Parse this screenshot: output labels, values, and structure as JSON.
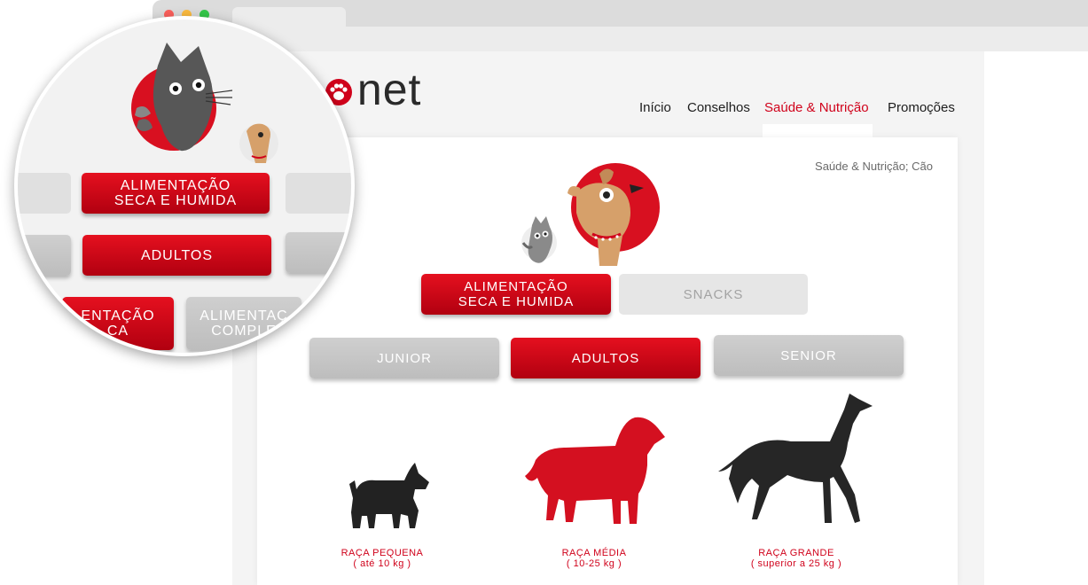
{
  "site": {
    "logo_text": "t",
    "logo_text_after": "net"
  },
  "nav": {
    "items": [
      "Início",
      "Conselhos",
      "Saúde & Nutrição",
      "Promoções"
    ],
    "active": "Saúde & Nutrição"
  },
  "breadcrumb": "Saúde & Nutrição; Cão",
  "food_types": [
    {
      "line1": "ALIMENTAÇÃO",
      "line2": "SECA E HUMIDA",
      "selected": true
    },
    {
      "line1": "SNACKS",
      "line2": "",
      "selected": false
    }
  ],
  "life_stages": [
    {
      "label": "JUNIOR",
      "selected": false
    },
    {
      "label": "ADULTOS",
      "selected": true
    },
    {
      "label": "SENIOR",
      "selected": false
    }
  ],
  "breeds": [
    {
      "name": "RAÇA PEQUENA",
      "range": "( até 10 kg )",
      "selected": false
    },
    {
      "name": "RAÇA MÉDIA",
      "range": "( 10-25 kg )",
      "selected": true
    },
    {
      "name": "RAÇA GRANDE",
      "range": "( superior a 25 kg )",
      "selected": false
    }
  ],
  "zoom": {
    "food_label_1": "ALIMENTAÇÃO",
    "food_label_2": "SECA E HUMIDA",
    "stage_label": "ADULTOS",
    "bottom_left_1": "ENTAÇÃO",
    "bottom_left_2": "CA",
    "bottom_right_1": "ALIMENTAÇ",
    "bottom_right_2": "COMPLE"
  },
  "colors": {
    "brand_red": "#d0021b",
    "dark": "#2a2a2a",
    "gray_button": "#c6c6c6"
  },
  "icons": [
    "cat-icon",
    "dog-icon",
    "paw-icon",
    "scottish-terrier-silhouette",
    "golden-retriever-silhouette",
    "greyhound-silhouette"
  ]
}
